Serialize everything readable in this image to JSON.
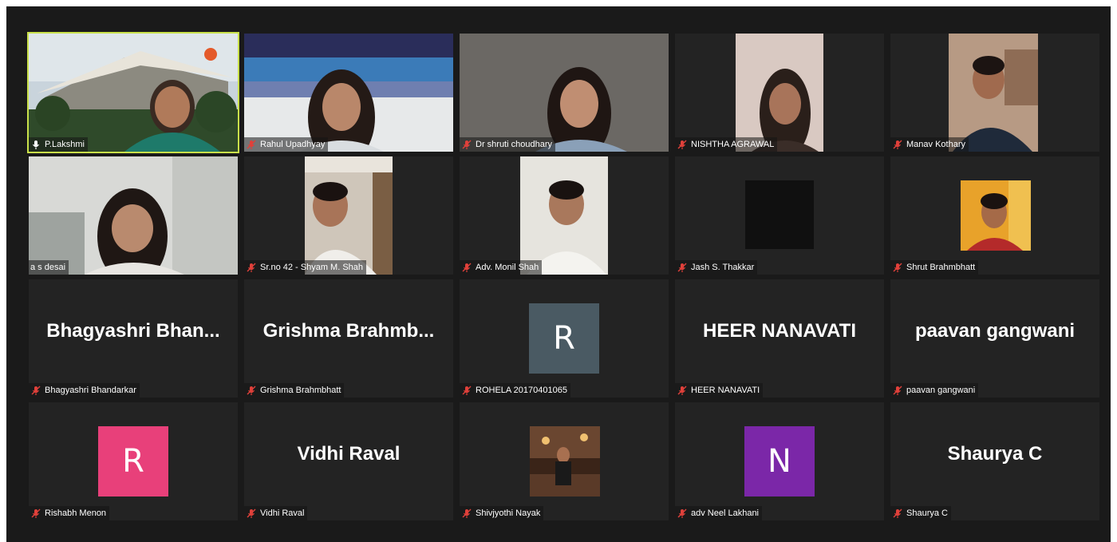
{
  "colors": {
    "window_bg": "#1a1a1a",
    "tile_bg": "#232323",
    "active_speaker_border": "#c9e04a",
    "muted_icon": "#e0403a"
  },
  "participants": [
    {
      "name": "P.Lakshmi",
      "active": true,
      "muted": false,
      "video": "building"
    },
    {
      "name": "Rahul Upadhyay",
      "muted": true,
      "video": "flag"
    },
    {
      "name": "Dr shruti choudhary",
      "muted": true,
      "video": "grey"
    },
    {
      "name": "NISHTHA AGRAWAL",
      "muted": true,
      "video": "pink"
    },
    {
      "name": "Manav Kothary",
      "muted": true,
      "video": "room"
    },
    {
      "name": "a s desai",
      "muted": false,
      "video": "white"
    },
    {
      "name": "Sr.no 42 - Shyam M. Shah",
      "muted": true,
      "video": "ceiling"
    },
    {
      "name": "Adv. Monil Shah",
      "muted": true,
      "video": "lightroom"
    },
    {
      "name": "Jash S. Thakkar",
      "muted": true,
      "video": "black"
    },
    {
      "name": "Shrut Brahmbhatt",
      "muted": true,
      "video": "orange"
    },
    {
      "name": "Bhagyashri Bhandarkar",
      "display": "Bhagyashri  Bhan...",
      "muted": true
    },
    {
      "name": "Grishma Brahmbhatt",
      "display": "Grishma  Brahmb...",
      "muted": true
    },
    {
      "name": "ROHELA 20170401065",
      "avatar_letter": "R",
      "avatar_color": "#4a5a63",
      "muted": true
    },
    {
      "name": "HEER NANAVATI",
      "display": "HEER NANAVATI",
      "muted": true
    },
    {
      "name": "paavan gangwani",
      "display": "paavan gangwani",
      "muted": true
    },
    {
      "name": "Rishabh Menon",
      "avatar_letter": "R",
      "avatar_color": "#e8407a",
      "muted": true
    },
    {
      "name": "Vidhi Raval",
      "display": "Vidhi Raval",
      "muted": true
    },
    {
      "name": "Shivjyothi Nayak",
      "muted": true,
      "video": "restaurant"
    },
    {
      "name": "adv Neel Lakhani",
      "avatar_letter": "N",
      "avatar_color": "#7b27a8",
      "muted": true
    },
    {
      "name": "Shaurya C",
      "display": "Shaurya C",
      "muted": true
    }
  ]
}
